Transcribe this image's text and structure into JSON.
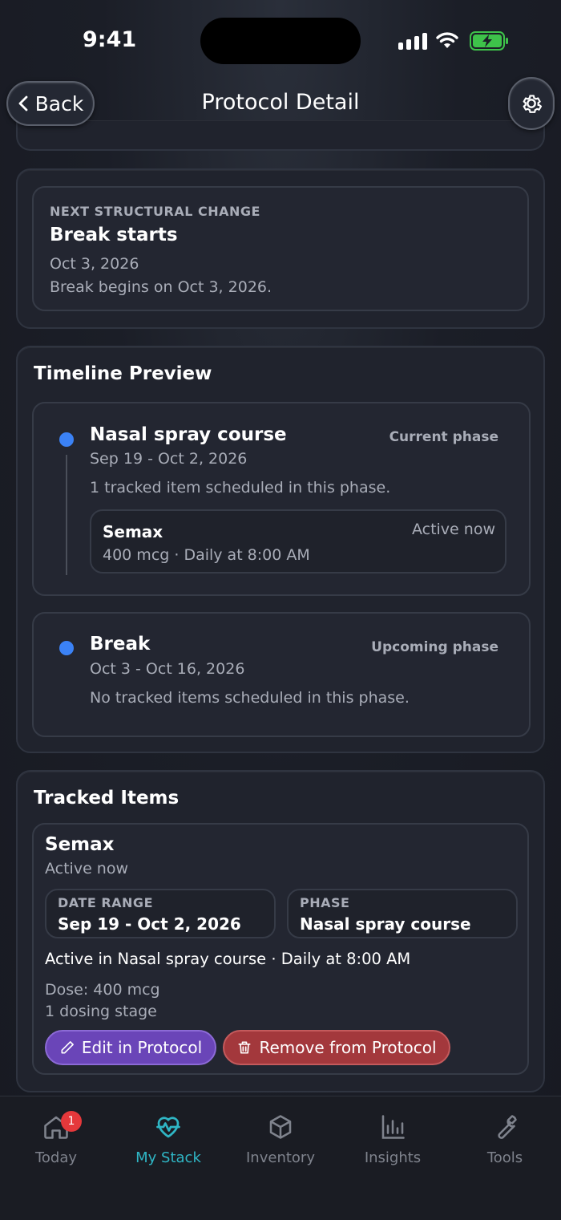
{
  "status_bar": {
    "time": "9:41"
  },
  "nav": {
    "back_label": "Back",
    "title": "Protocol Detail"
  },
  "next_change": {
    "caption": "NEXT STRUCTURAL CHANGE",
    "title": "Break starts",
    "date": "Oct 3, 2026",
    "description": "Break begins on Oct 3, 2026."
  },
  "timeline": {
    "title": "Timeline Preview",
    "phases": [
      {
        "name": "Nasal spray course",
        "status": "Current phase",
        "dates": "Sep 19 - Oct 2, 2026",
        "summary": "1 tracked item scheduled in this phase.",
        "item": {
          "name": "Semax",
          "status": "Active now",
          "detail": "400 mcg · Daily at 8:00 AM"
        }
      },
      {
        "name": "Break",
        "status": "Upcoming phase",
        "dates": "Oct 3 - Oct 16, 2026",
        "summary": "No tracked items scheduled in this phase."
      }
    ]
  },
  "tracked": {
    "title": "Tracked Items",
    "item": {
      "name": "Semax",
      "status": "Active now",
      "date_range_label": "DATE RANGE",
      "date_range": "Sep 19 - Oct 2, 2026",
      "phase_label": "PHASE",
      "phase": "Nasal spray course",
      "schedule": "Active in Nasal spray course · Daily at 8:00 AM",
      "dose": "Dose: 400 mcg",
      "stages": "1 dosing stage",
      "edit_label": "Edit in Protocol",
      "remove_label": "Remove from Protocol"
    }
  },
  "tabbar": {
    "tabs": [
      {
        "label": "Today",
        "icon": "home-icon",
        "badge": "1"
      },
      {
        "label": "My Stack",
        "icon": "heart-pulse-icon",
        "active": true
      },
      {
        "label": "Inventory",
        "icon": "box-icon"
      },
      {
        "label": "Insights",
        "icon": "bar-chart-icon"
      },
      {
        "label": "Tools",
        "icon": "wrench-icon"
      }
    ]
  },
  "colors": {
    "accent_blue": "#3b82f6",
    "active_tab": "#2fb6c5",
    "edit_button": "#6a45b8",
    "remove_button": "#a3383c",
    "badge": "#e5383b"
  }
}
